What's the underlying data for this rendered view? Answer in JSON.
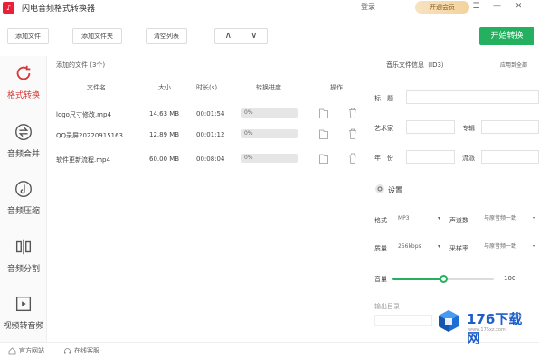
{
  "window": {
    "title": "闪电音频格式转换器",
    "logo_glyph": "♪",
    "login_label": "登录",
    "vip_label": "开通会员"
  },
  "toolbar": {
    "add_file": "添加文件",
    "add_folder": "添加文件夹",
    "clear_list": "清空列表",
    "up_arrow": "∧",
    "down_arrow": "∨",
    "start": "开始转换"
  },
  "sidebar": {
    "items": [
      {
        "label": "格式转换",
        "icon": "refresh-icon",
        "active": true
      },
      {
        "label": "音频合并",
        "icon": "merge-icon"
      },
      {
        "label": "音频压缩",
        "icon": "compress-icon"
      },
      {
        "label": "音频分割",
        "icon": "split-icon"
      },
      {
        "label": "视频转音频",
        "icon": "video-to-audio-icon"
      }
    ]
  },
  "file_list": {
    "count_label": "添加的文件 (3个)",
    "columns": [
      "文件名",
      "大小",
      "时长(s)",
      "转换进度",
      "操作"
    ],
    "rows": [
      {
        "name": "logo尺寸修改.mp4",
        "size": "14.63 MB",
        "duration": "00:01:54",
        "progress": "0%"
      },
      {
        "name": "QQ录屏20220915163...",
        "size": "12.89 MB",
        "duration": "00:01:12",
        "progress": "0%"
      },
      {
        "name": "软件更新流程.mp4",
        "size": "60.00 MB",
        "duration": "00:08:04",
        "progress": "0%"
      }
    ]
  },
  "metadata": {
    "header": "音乐文件信息（ID3）",
    "apply_all": "应用到全部",
    "title_label": "标　题",
    "artist_label": "艺术家",
    "album_label": "专辑",
    "year_label": "年　份",
    "genre_label": "流派"
  },
  "settings": {
    "header": "设置",
    "format_label": "格式",
    "format_value": "MP3",
    "channels_label": "声道数",
    "channels_value": "与原音频一致",
    "quality_label": "质量",
    "quality_value": "256kbps",
    "samplerate_label": "采样率",
    "samplerate_value": "与原音频一致",
    "volume_label": "音量",
    "volume_value": "100",
    "volume_percent": 0.5,
    "output_label": "输出目录"
  },
  "bottom": {
    "website": "官方网站",
    "support": "在线客服"
  },
  "watermark": {
    "brand": "176下载网",
    "url": "www.176xz.com"
  },
  "colors": {
    "accent": "#25b060",
    "active": "#d6383a",
    "brand_red": "#e8203a"
  }
}
